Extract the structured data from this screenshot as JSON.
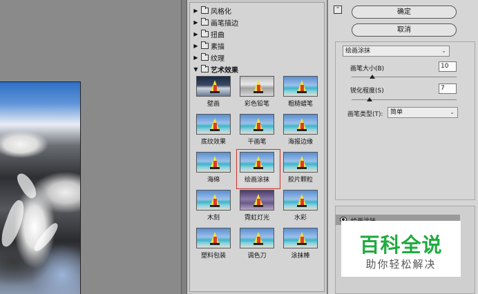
{
  "gallery": {
    "folders": [
      {
        "label": "风格化",
        "open": false
      },
      {
        "label": "画笔描边",
        "open": false
      },
      {
        "label": "扭曲",
        "open": false
      },
      {
        "label": "素描",
        "open": false
      },
      {
        "label": "纹理",
        "open": false
      },
      {
        "label": "艺术效果",
        "open": true
      }
    ],
    "filters": [
      "壁画",
      "彩色铅笔",
      "粗糙蜡笔",
      "底纹效果",
      "干画笔",
      "海报边缘",
      "海绵",
      "绘画涂抹",
      "胶片颗粒",
      "木刻",
      "霓虹灯光",
      "水彩",
      "塑料包装",
      "调色刀",
      "涂抹棒"
    ],
    "selected_filter": "绘画涂抹"
  },
  "settings": {
    "collapse_icon": "⌃",
    "ok_label": "确定",
    "cancel_label": "取消",
    "filter_select": "绘画涂抹",
    "brush_size_label": "画笔大小(B)",
    "brush_size_value": "10",
    "brush_size_fraction": 0.2,
    "sharpness_label": "锐化程度(S)",
    "sharpness_value": "7",
    "sharpness_fraction": 0.17,
    "brush_type_label": "画笔类型(T):",
    "brush_type_value": "简单",
    "layer_name": "绘画涂抹"
  },
  "watermark": {
    "main": "百科全说",
    "sub": "助你轻松解决",
    "color": "#1fab3f"
  }
}
